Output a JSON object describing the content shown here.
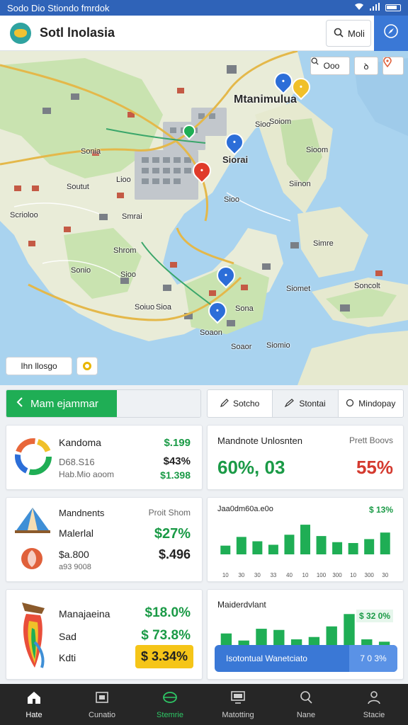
{
  "status_bar": {
    "text": "Sodo Dio Stiondo fmrdok"
  },
  "app_bar": {
    "title": "Sotl lnolasia",
    "search_label": "Moli"
  },
  "map": {
    "controls": {
      "button1": "Ooo",
      "button2": "ꝺ"
    },
    "labels": {
      "city": "Mtanimulua",
      "district": "Siorai",
      "place1": "Sonia",
      "place2": "Soiom",
      "place3": "Lioo",
      "place4": "Sioom",
      "place5": "Smrai",
      "place6": "Siinon",
      "place7": "Sioo",
      "place8": "Simre",
      "place9": "Sonio",
      "place10": "Siomet",
      "place11": "Soiuo",
      "place12": "Sioa",
      "place13": "Soncolt",
      "place14": "Siomio",
      "place15": "Soaor",
      "place16": "Soutut",
      "place17": "Scrioloo",
      "place18": "Soaon",
      "place19": "Shrom",
      "place20": "Sona",
      "place21": "Sioo",
      "place22": "Sioo"
    },
    "chip_label": "Ihn llosgo"
  },
  "tabs": {
    "left_active": "Mam ejammar",
    "right": [
      "Sotcho",
      "Stontai",
      "Mindopay"
    ]
  },
  "card1": {
    "title": "Kandoma",
    "line2": "D68.S16",
    "line3": "Hab.Mio aoom",
    "v1": "$.199",
    "v2": "$43%",
    "v3": "$1.398"
  },
  "card2": {
    "title": "Mandnote Unlosnten",
    "sub": "Prett Boovs",
    "big_left": "60%, 03",
    "big_right": "55%"
  },
  "card3": {
    "title": "Mandnents",
    "sub": "Proit Shom",
    "line2": "Malerlal",
    "line3": "$a.800",
    "line4": "a93 9008",
    "v1": "$27%",
    "v2": "$.496"
  },
  "card4": {
    "title": "Jaa0dm60a.e0o",
    "corner": "$ 13%",
    "xticks": [
      "10",
      "30",
      "30",
      "33",
      "40",
      "10",
      "100",
      "300",
      "10",
      "300",
      "30"
    ]
  },
  "card5": {
    "line1": "Manajaeina",
    "line2": "Sad",
    "line3": "Kdti",
    "v1": "$18.0%",
    "v2": "$ 73.8%",
    "v3": "$ 3.34%"
  },
  "card6": {
    "title": "Maiderdvlant",
    "corner": "$ 32 0%",
    "banner": "Isotontual Wanetciato",
    "banner_right": "7 0 3%"
  },
  "chart_data": [
    {
      "type": "bar",
      "title": "Jaa0dm60a.e0o",
      "categories": [
        "10",
        "30",
        "30",
        "33",
        "40",
        "10",
        "100",
        "300",
        "10",
        "300",
        "30"
      ],
      "values": [
        20,
        40,
        30,
        22,
        45,
        68,
        42,
        28,
        26,
        35,
        50
      ]
    },
    {
      "type": "bar",
      "title": "Maiderdvlant",
      "values": [
        22,
        10,
        30,
        28,
        12,
        16,
        34,
        55,
        12,
        8
      ]
    }
  ],
  "bottom_nav": [
    "Hate",
    "Cunatio",
    "Stemrie",
    "Matotting",
    "Nane",
    "Stacie"
  ],
  "colors": {
    "brand_blue": "#2f63b8",
    "accent_green": "#1fae55",
    "alert_red": "#d43a2f",
    "warning_yellow": "#f5c518",
    "nav_bg": "#262626"
  },
  "icons": [
    "wifi-icon",
    "signal-icon",
    "battery-icon",
    "search-icon",
    "compass-icon",
    "map-pin-icon",
    "chevron-left-icon",
    "pen-icon",
    "person-icon",
    "circle-icon",
    "home-icon",
    "calendar-icon",
    "globe-icon",
    "monitor-icon",
    "person-search-icon"
  ]
}
